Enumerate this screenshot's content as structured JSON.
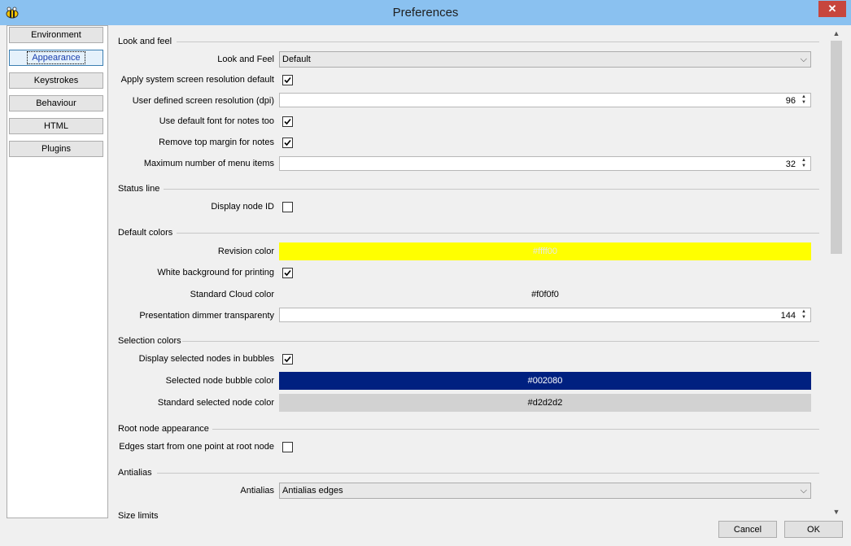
{
  "window": {
    "title": "Preferences",
    "close_glyph": "✕"
  },
  "sidebar": {
    "items": [
      "Environment",
      "Appearance",
      "Keystrokes",
      "Behaviour",
      "HTML",
      "Plugins"
    ],
    "active": "Appearance"
  },
  "sections": {
    "look_and_feel": "Look and feel",
    "status_line": "Status line",
    "default_colors": "Default colors",
    "selection_colors": "Selection colors",
    "root_node": "Root node appearance",
    "antialias": "Antialias",
    "size_limits": "Size limits"
  },
  "fields": {
    "look_and_feel": {
      "label": "Look and Feel",
      "value": "Default"
    },
    "apply_resolution": {
      "label": "Apply system screen resolution default",
      "checked": true
    },
    "user_resolution": {
      "label": "User defined screen resolution (dpi)",
      "value": "96"
    },
    "default_font": {
      "label": "Use default font for notes too",
      "checked": true
    },
    "remove_margin": {
      "label": "Remove top margin for notes",
      "checked": true
    },
    "max_menu": {
      "label": "Maximum number of menu items",
      "value": "32"
    },
    "display_node_id": {
      "label": "Display node ID",
      "checked": false
    },
    "revision_color": {
      "label": "Revision color",
      "value": "#ffff00"
    },
    "white_bg": {
      "label": "White background for printing",
      "checked": true
    },
    "cloud_color": {
      "label": "Standard Cloud color",
      "value": "#f0f0f0"
    },
    "dimmer": {
      "label": "Presentation dimmer transparenty",
      "value": "144"
    },
    "display_bubbles": {
      "label": "Display selected nodes in bubbles",
      "checked": true
    },
    "bubble_color": {
      "label": "Selected node bubble color",
      "value": "#002080"
    },
    "std_selected": {
      "label": "Standard selected node color",
      "value": "#d2d2d2"
    },
    "edges_one_point": {
      "label": "Edges start from one point at root node",
      "checked": false
    },
    "antialias": {
      "label": "Antialias",
      "value": "Antialias edges"
    }
  },
  "buttons": {
    "cancel": "Cancel",
    "ok": "OK"
  },
  "colors": {
    "titlebar": "#8ac1f0",
    "revision": "#ffff00",
    "bubble": "#002080",
    "std_selected": "#d2d2d2"
  },
  "icons": {
    "app": "bee-icon",
    "close": "close-icon",
    "check": "checkmark-icon",
    "combo": "chevron-down-icon"
  }
}
